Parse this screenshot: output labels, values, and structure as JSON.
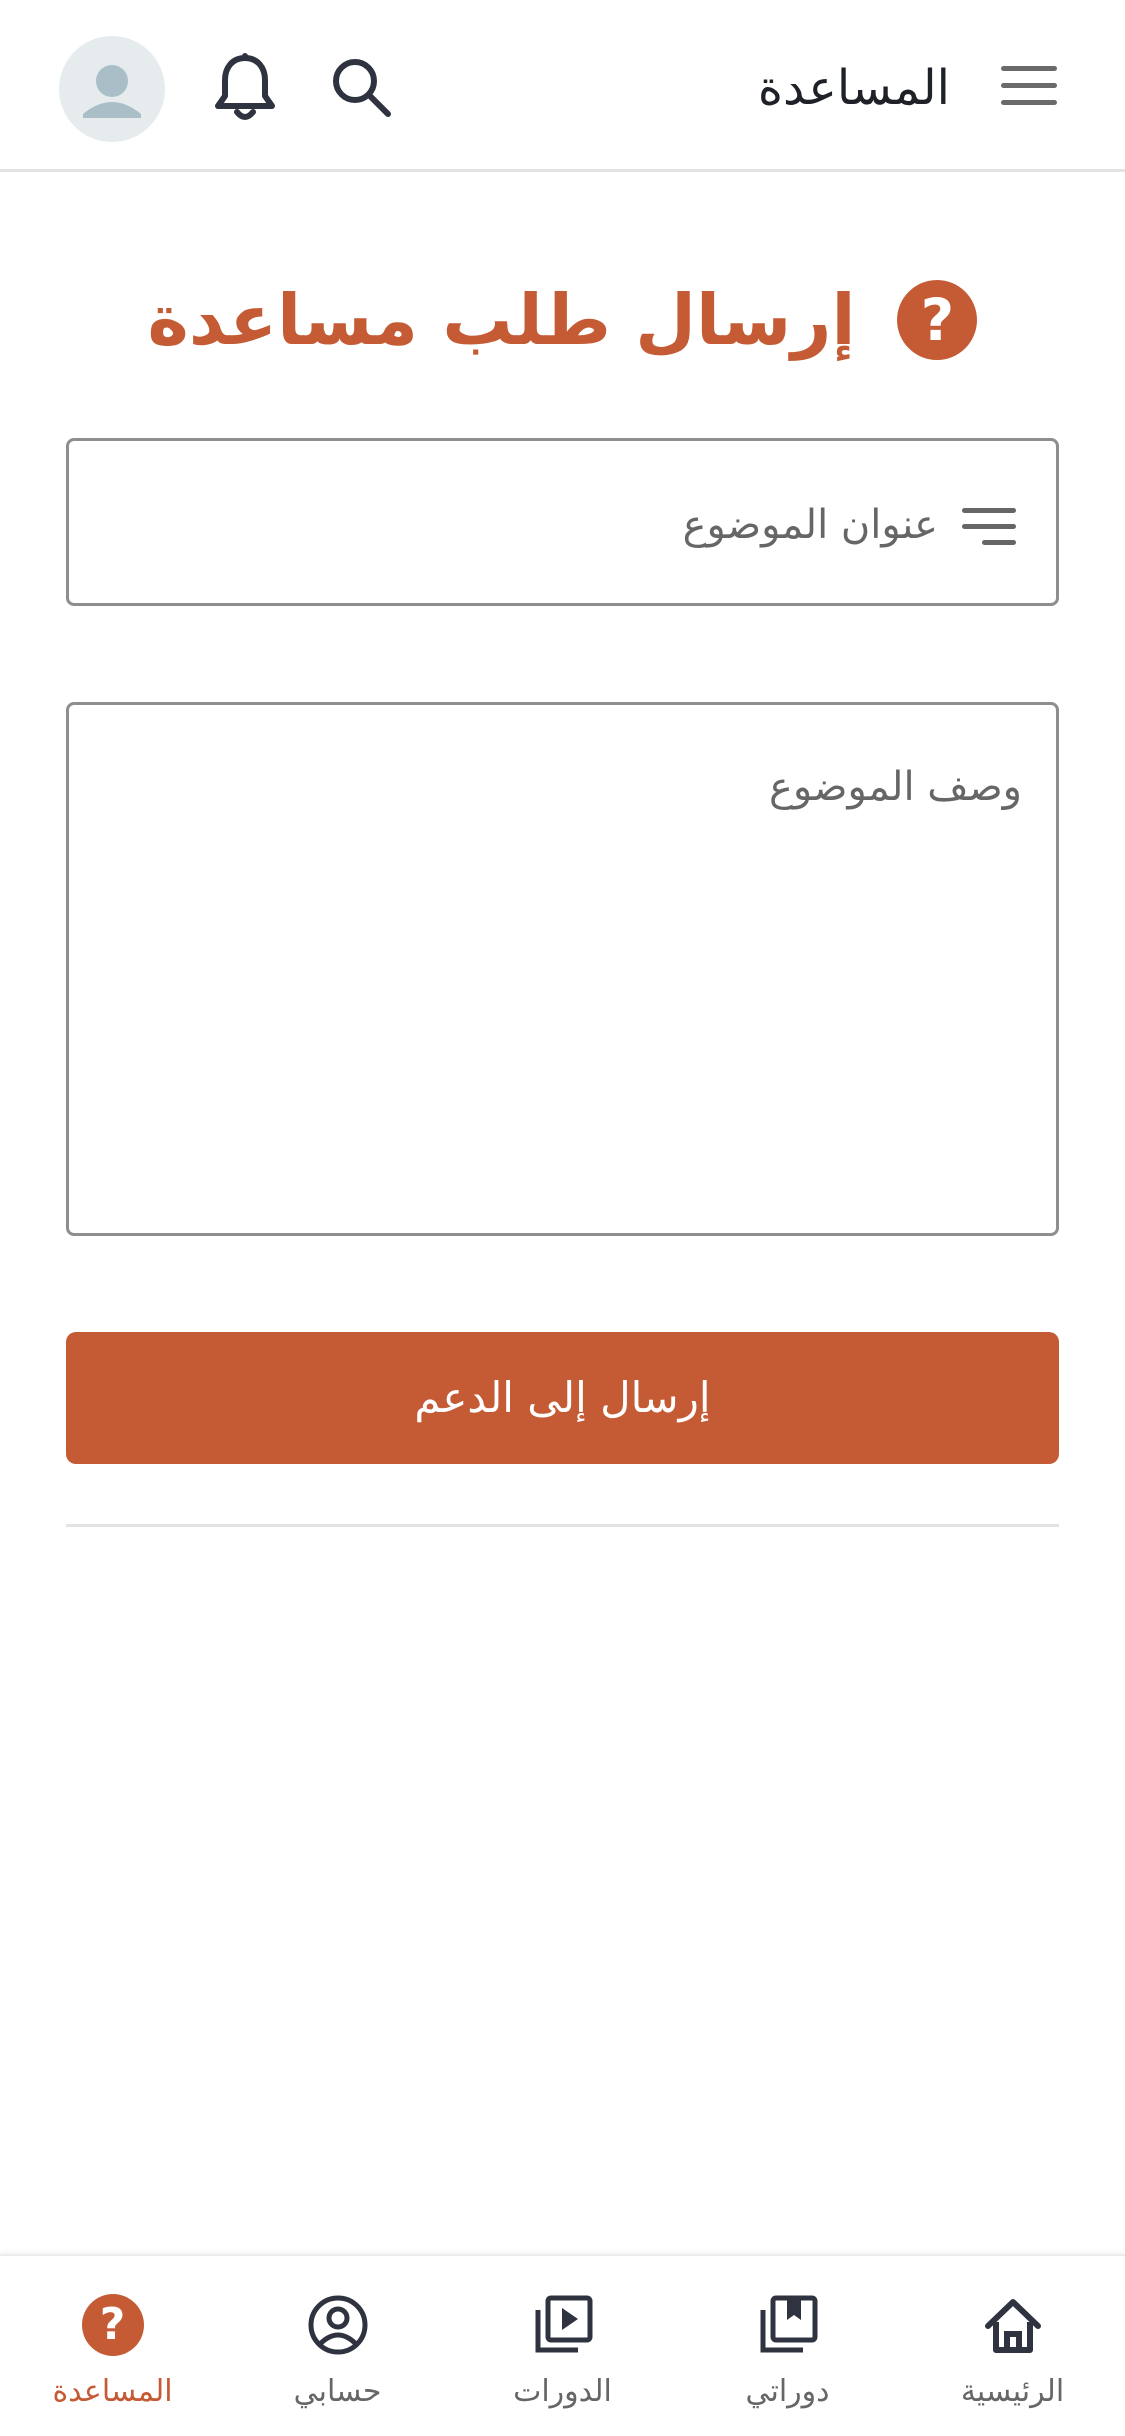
{
  "header": {
    "title": "المساعدة",
    "icons": {
      "menu": "menu-icon",
      "search": "search-icon",
      "notifications": "bell-icon",
      "avatar": "user-avatar-icon"
    }
  },
  "form": {
    "heading": "إرسال طلب مساعدة",
    "heading_icon": "question-circle-icon",
    "subject_placeholder": "عنوان الموضوع",
    "description_placeholder": "وصف الموضوع",
    "submit_label": "إرسال إلى الدعم"
  },
  "bottom_nav": {
    "items": [
      {
        "label": "الرئيسية",
        "icon": "home-icon",
        "active": false
      },
      {
        "label": "دوراتي",
        "icon": "my-courses-icon",
        "active": false
      },
      {
        "label": "الدورات",
        "icon": "courses-play-icon",
        "active": false
      },
      {
        "label": "حسابي",
        "icon": "account-icon",
        "active": false
      },
      {
        "label": "المساعدة",
        "icon": "help-icon",
        "active": true
      }
    ]
  },
  "colors": {
    "accent": "#c45b35",
    "text": "#2b2d36",
    "muted": "#666666",
    "border": "#8e8e8e"
  }
}
